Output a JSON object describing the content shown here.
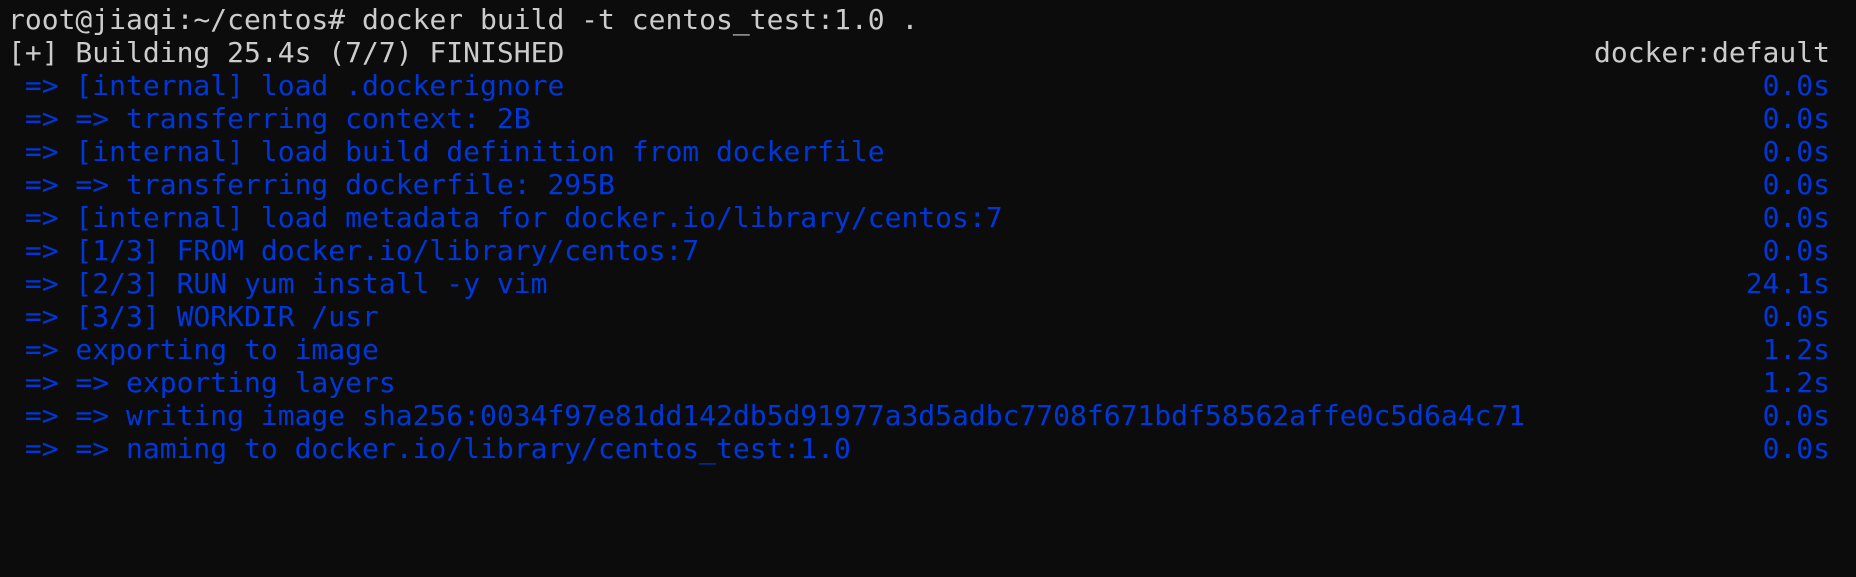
{
  "prompt": "root@jiaqi:~/centos#",
  "command": "docker build -t centos_test:1.0 .",
  "header": {
    "status": "[+] Building 25.4s (7/7) FINISHED",
    "builder": "docker:default"
  },
  "steps": [
    {
      "text": " => [internal] load .dockerignore",
      "time": "0.0s"
    },
    {
      "text": " => => transferring context: 2B",
      "time": "0.0s"
    },
    {
      "text": " => [internal] load build definition from dockerfile",
      "time": "0.0s"
    },
    {
      "text": " => => transferring dockerfile: 295B",
      "time": "0.0s"
    },
    {
      "text": " => [internal] load metadata for docker.io/library/centos:7",
      "time": "0.0s"
    },
    {
      "text": " => [1/3] FROM docker.io/library/centos:7",
      "time": "0.0s"
    },
    {
      "text": " => [2/3] RUN yum install -y vim",
      "time": "24.1s"
    },
    {
      "text": " => [3/3] WORKDIR /usr",
      "time": "0.0s"
    },
    {
      "text": " => exporting to image",
      "time": "1.2s"
    },
    {
      "text": " => => exporting layers",
      "time": "1.2s"
    },
    {
      "text": " => => writing image sha256:0034f97e81dd142db5d91977a3d5adbc7708f671bdf58562affe0c5d6a4c71",
      "time": "0.0s"
    },
    {
      "text": " => => naming to docker.io/library/centos_test:1.0",
      "time": "0.0s"
    }
  ],
  "colors": {
    "background": "#0c0c0c",
    "default_text": "#cccccc",
    "step_text": "#0037da"
  }
}
